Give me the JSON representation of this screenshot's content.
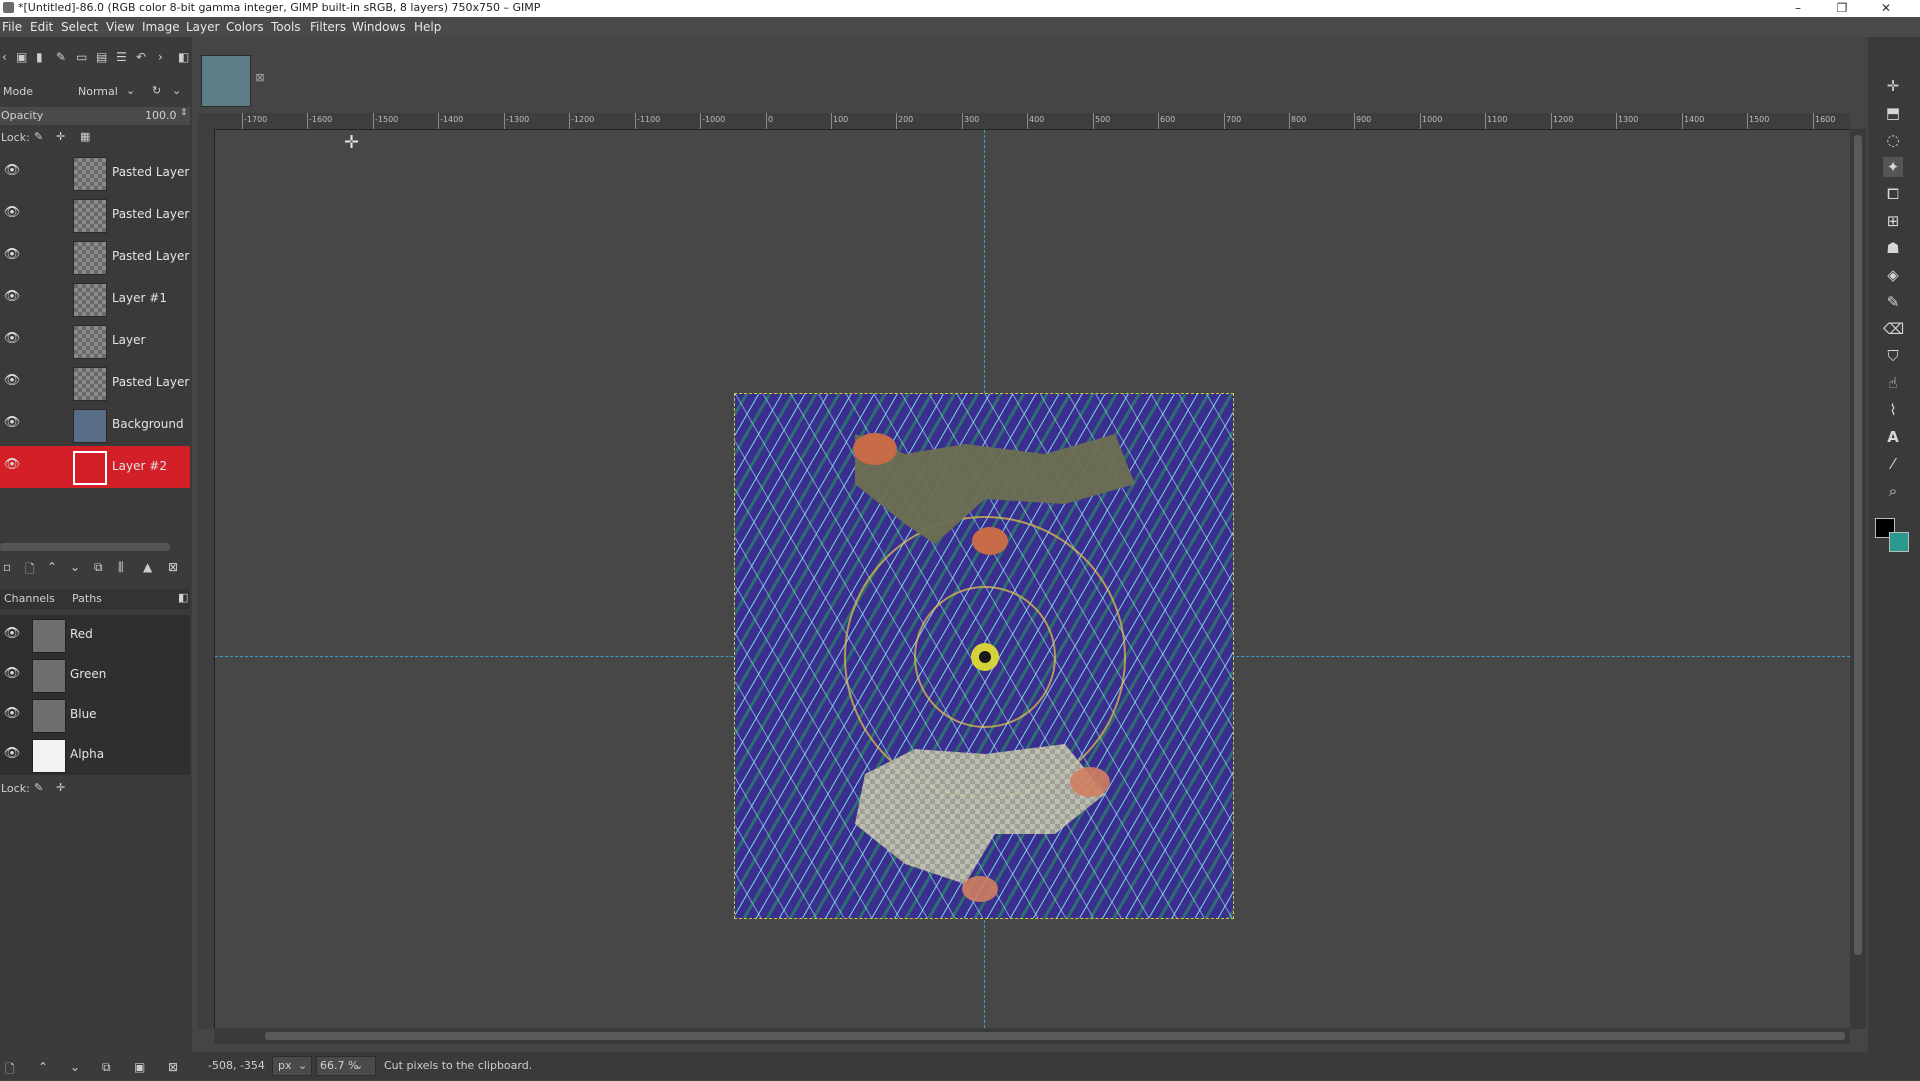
{
  "window": {
    "title": "*[Untitled]-86.0 (RGB color 8-bit gamma integer, GIMP built-in sRGB, 8 layers) 750x750 – GIMP",
    "minimize": "–",
    "maximize": "❐",
    "close": "✕"
  },
  "menu": [
    "File",
    "Edit",
    "Select",
    "View",
    "Image",
    "Layer",
    "Colors",
    "Tools",
    "Filters",
    "Windows",
    "Help"
  ],
  "layers_panel": {
    "mode_label": "Mode",
    "mode_value": "Normal",
    "opacity_label": "Opacity",
    "opacity_value": "100.0",
    "lock_label": "Lock:",
    "layers": [
      {
        "name": "Pasted Layer",
        "selected": false
      },
      {
        "name": "Pasted Layer",
        "selected": false
      },
      {
        "name": "Pasted Layer",
        "selected": false
      },
      {
        "name": "Layer #1",
        "selected": false
      },
      {
        "name": "Layer",
        "selected": false
      },
      {
        "name": "Pasted Layer",
        "selected": false
      },
      {
        "name": "Background",
        "selected": false
      },
      {
        "name": "Layer #2",
        "selected": true
      }
    ]
  },
  "channels_panel": {
    "tab_channels": "Channels",
    "tab_paths": "Paths",
    "lock_label": "Lock:",
    "channels": [
      "Red",
      "Green",
      "Blue",
      "Alpha"
    ]
  },
  "rulers": {
    "h_ticks": [
      "-1700",
      "-1600",
      "-1500",
      "-1400",
      "-1300",
      "-1200",
      "-1100",
      "-1000",
      "0",
      "100",
      "200",
      "300",
      "400",
      "500",
      "600",
      "700",
      "800",
      "900",
      "1000",
      "1100",
      "1200",
      "1300",
      "1400",
      "1500",
      "1600"
    ]
  },
  "status": {
    "coords": "-508, -354",
    "unit": "px",
    "zoom": "66.7 %",
    "message": "Cut pixels to the clipboard."
  },
  "icons": {
    "eye": "eye-icon",
    "tools": [
      "move-tool-icon",
      "align-tool-icon",
      "free-select-icon",
      "fuzzy-select-icon",
      "crop-icon",
      "transform-icon",
      "warp-icon",
      "bucket-fill-icon",
      "paintbrush-icon",
      "eraser-icon",
      "clone-icon",
      "smudge-icon",
      "paths-icon",
      "text-icon",
      "color-picker-icon",
      "zoom-icon"
    ]
  },
  "colors": {
    "selected_layer": "#d31f27",
    "foreground": "#000000",
    "background": "#2a9a8f",
    "guide": "#3aa0c8"
  }
}
